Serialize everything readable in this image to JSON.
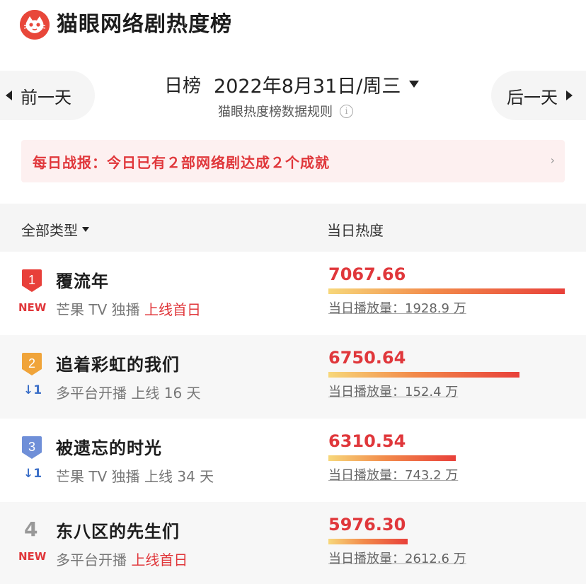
{
  "header": {
    "title": "猫眼网络剧热度榜"
  },
  "date_nav": {
    "prev_label": "前一天",
    "next_label": "后一天",
    "type_label": "日榜",
    "date_value": "2022年8月31日/周三",
    "rules_label": "猫眼热度榜数据规则"
  },
  "banner": {
    "text": "每日战报：今日已有２部网络剧达成２个成就"
  },
  "columns": {
    "filter_label": "全部类型",
    "heat_label": "当日热度"
  },
  "rows": [
    {
      "rank": "1",
      "badge": "NEW",
      "title": "覆流年",
      "platform": "芒果 TV 独播",
      "online": "上线首日",
      "heat": "7067.66",
      "heat_value": 7067.66,
      "views": "当日播放量：1928.9 万"
    },
    {
      "rank": "2",
      "badge": "↓1",
      "title": "追着彩虹的我们",
      "platform": "多平台开播",
      "online": "上线 16 天",
      "heat": "6750.64",
      "heat_value": 6750.64,
      "views": "当日播放量：152.4 万"
    },
    {
      "rank": "3",
      "badge": "↓1",
      "title": "被遗忘的时光",
      "platform": "芒果 TV 独播",
      "online": "上线 34 天",
      "heat": "6310.54",
      "heat_value": 6310.54,
      "views": "当日播放量：743.2 万"
    },
    {
      "rank": "4",
      "badge": "NEW",
      "title": "东八区的先生们",
      "platform": "多平台开播",
      "online": "上线首日",
      "heat": "5976.30",
      "heat_value": 5976.3,
      "views": "当日播放量：2612.6 万"
    }
  ],
  "colors": {
    "accent_red": "#e0373b",
    "rank1": "#e8403a",
    "rank2": "#f0a43a",
    "rank3": "#6f8fd8",
    "rank_down": "#3b6fc8"
  }
}
